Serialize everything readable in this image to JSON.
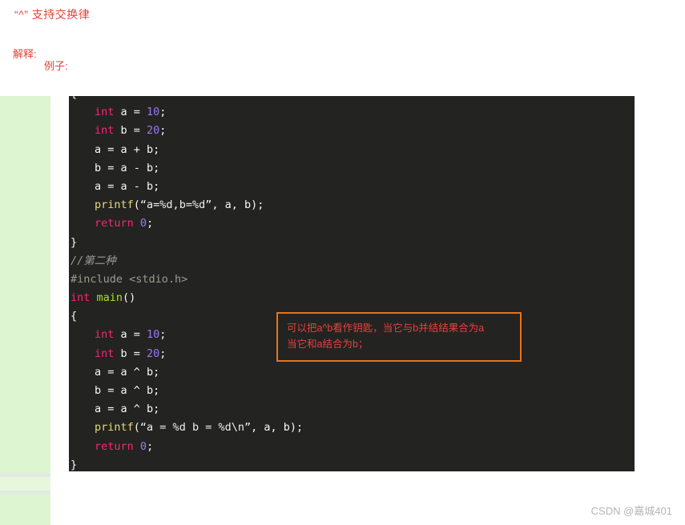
{
  "page": {
    "heading": "“^” 支持交换律",
    "explain_label": "解释:",
    "example_label": "例子:",
    "watermark": "CSDN @嘉城401"
  },
  "theme": {
    "background": "#ffffff",
    "code_background": "#232322",
    "green_panel": "#ddf5d0",
    "red_text": "#e8413c",
    "callout_border": "#e8731c",
    "keyword": "#f92672",
    "number": "#9a79f0",
    "function": "#e6db74",
    "function_alt": "#a6e22e",
    "comment": "#9b9b93",
    "plain": "#f8f8f2",
    "watermark": "#b5b5b5"
  },
  "code": {
    "language": "c",
    "lines": [
      {
        "indent": true,
        "tokens": [
          {
            "t": "int",
            "c": "kw"
          },
          {
            "t": " a = ",
            "c": "plain"
          },
          {
            "t": "10",
            "c": "num"
          },
          {
            "t": ";",
            "c": "punct"
          }
        ]
      },
      {
        "indent": true,
        "tokens": [
          {
            "t": "int",
            "c": "kw"
          },
          {
            "t": " b = ",
            "c": "plain"
          },
          {
            "t": "20",
            "c": "num"
          },
          {
            "t": ";",
            "c": "punct"
          }
        ]
      },
      {
        "indent": true,
        "tokens": [
          {
            "t": "a = a + b;",
            "c": "plain"
          }
        ]
      },
      {
        "indent": true,
        "tokens": [
          {
            "t": "b = a - b;",
            "c": "plain"
          }
        ]
      },
      {
        "indent": true,
        "tokens": [
          {
            "t": "a = a - b;",
            "c": "plain"
          }
        ]
      },
      {
        "indent": true,
        "tokens": [
          {
            "t": "printf",
            "c": "fn"
          },
          {
            "t": "(",
            "c": "punct"
          },
          {
            "t": "“a=%d,b=%d”",
            "c": "str"
          },
          {
            "t": ", a, b);",
            "c": "punct"
          }
        ]
      },
      {
        "indent": true,
        "tokens": [
          {
            "t": "return",
            "c": "kw"
          },
          {
            "t": " ",
            "c": "plain"
          },
          {
            "t": "0",
            "c": "num"
          },
          {
            "t": ";",
            "c": "punct"
          }
        ]
      },
      {
        "indent": false,
        "tokens": [
          {
            "t": "}",
            "c": "plain"
          }
        ]
      },
      {
        "indent": false,
        "tokens": [
          {
            "t": "//第二种",
            "c": "comment"
          }
        ]
      },
      {
        "indent": false,
        "tokens": [
          {
            "t": "#include <stdio.h>",
            "c": "pre"
          }
        ]
      },
      {
        "indent": false,
        "tokens": [
          {
            "t": "int",
            "c": "kw"
          },
          {
            "t": " ",
            "c": "plain"
          },
          {
            "t": "main",
            "c": "fn2"
          },
          {
            "t": "()",
            "c": "punct"
          }
        ]
      },
      {
        "indent": false,
        "tokens": [
          {
            "t": "{",
            "c": "plain"
          }
        ]
      },
      {
        "indent": true,
        "tokens": [
          {
            "t": "int",
            "c": "kw"
          },
          {
            "t": " a = ",
            "c": "plain"
          },
          {
            "t": "10",
            "c": "num"
          },
          {
            "t": ";",
            "c": "punct"
          }
        ]
      },
      {
        "indent": true,
        "tokens": [
          {
            "t": "int",
            "c": "kw"
          },
          {
            "t": " b = ",
            "c": "plain"
          },
          {
            "t": "20",
            "c": "num"
          },
          {
            "t": ";",
            "c": "punct"
          }
        ]
      },
      {
        "indent": true,
        "tokens": [
          {
            "t": "a = a ^ b;",
            "c": "plain"
          }
        ]
      },
      {
        "indent": true,
        "tokens": [
          {
            "t": "b = a ^ b;",
            "c": "plain"
          }
        ]
      },
      {
        "indent": true,
        "tokens": [
          {
            "t": "a = a ^ b;",
            "c": "plain"
          }
        ]
      },
      {
        "indent": true,
        "tokens": [
          {
            "t": "printf",
            "c": "fn"
          },
          {
            "t": "(",
            "c": "punct"
          },
          {
            "t": "“a = %d b = %d\\n”",
            "c": "str"
          },
          {
            "t": ", a, b);",
            "c": "punct"
          }
        ]
      },
      {
        "indent": true,
        "tokens": [
          {
            "t": "return",
            "c": "kw"
          },
          {
            "t": " ",
            "c": "plain"
          },
          {
            "t": "0",
            "c": "num"
          },
          {
            "t": ";",
            "c": "punct"
          }
        ]
      },
      {
        "indent": false,
        "tokens": [
          {
            "t": "}",
            "c": "plain"
          }
        ]
      }
    ],
    "clipped_top_line": "{"
  },
  "callout": {
    "line1": "可以把a^b看作钥匙，当它与b并结结果合为a",
    "line2": "当它和a结合为b；"
  }
}
